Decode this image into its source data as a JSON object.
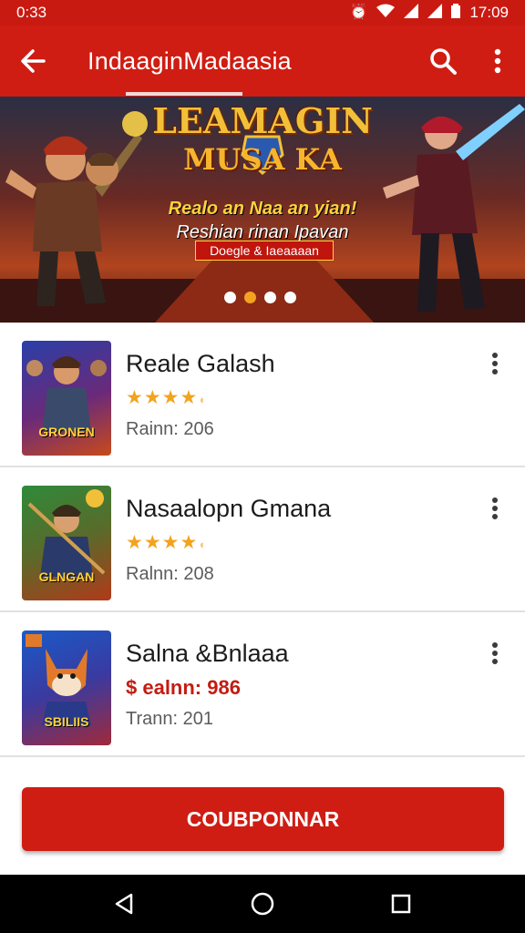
{
  "status_bar": {
    "time": "0:33",
    "clock": "17:09"
  },
  "app_bar": {
    "title": "IndaaginMadaasia"
  },
  "banner": {
    "title": "LEAMAGIN",
    "subtitle": "MUSA KA",
    "tagline": "Realo an Naa an yian!",
    "description": "Reshian rinan Ipavan",
    "badge": "Doegle & Iaeaaaan",
    "active_dot": 1,
    "dot_count": 4
  },
  "games": [
    {
      "title": "Reale Galash",
      "rating": 4.5,
      "meta": "Rainn: 206",
      "thumb_label": "GRONEN"
    },
    {
      "title": "Nasaalopn Gmana",
      "rating": 4.5,
      "meta": "Ralnn: 208",
      "thumb_label": "GLNGAN"
    },
    {
      "title": "Salna &Bnlaaa",
      "price": "$ ealnn: 986",
      "meta": "Trann: 201",
      "thumb_label": "SBILIIS"
    }
  ],
  "cta": {
    "label": "COUBPONNAR"
  },
  "colors": {
    "primary": "#cf1d13",
    "star": "#f3a31d",
    "price": "#c41c12"
  },
  "icons": [
    "back-arrow-icon",
    "search-icon",
    "more-vertical-icon",
    "wifi-icon",
    "signal-icon",
    "battery-icon",
    "nav-back-icon",
    "nav-home-icon",
    "nav-recents-icon"
  ]
}
